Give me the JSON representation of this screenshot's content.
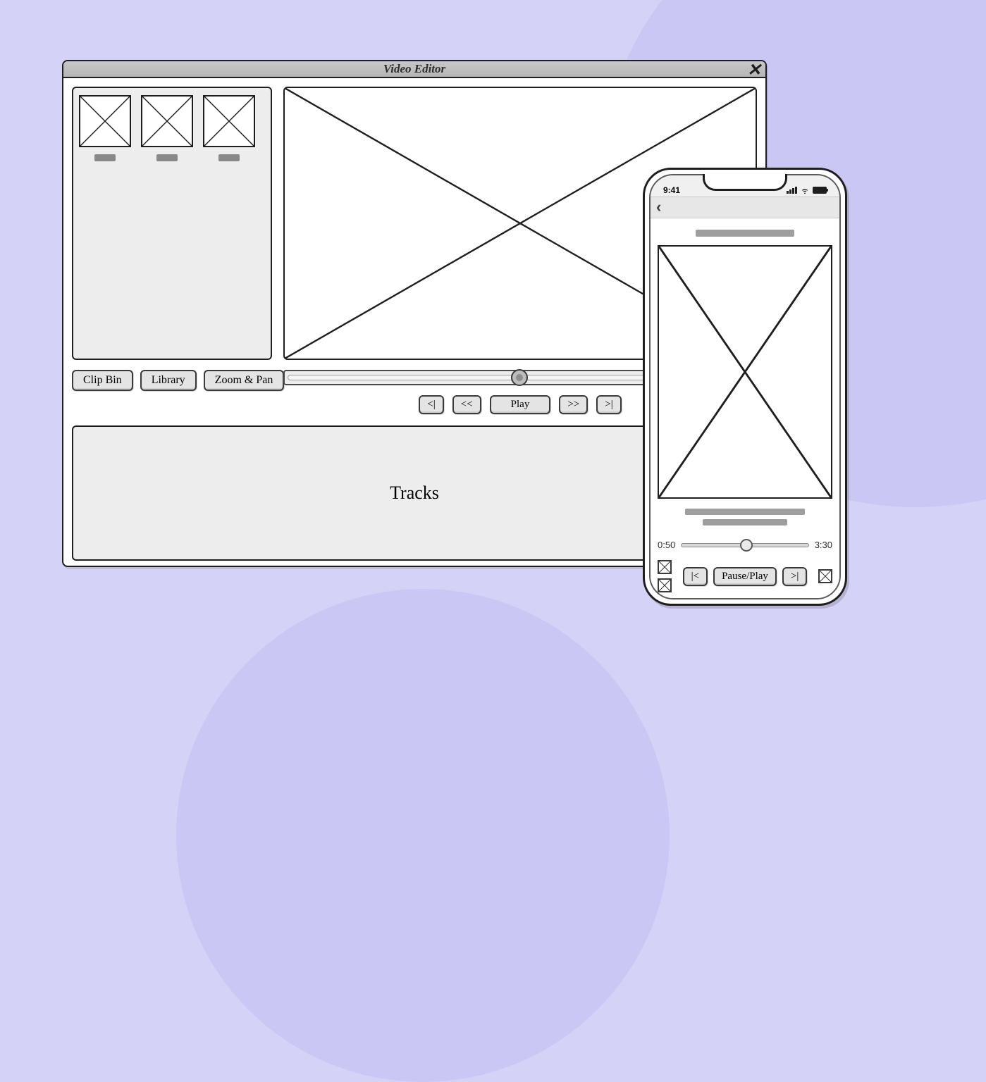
{
  "desktop": {
    "title": "Video Editor",
    "buttons": {
      "clip_bin": "Clip Bin",
      "library": "Library",
      "zoom_pan": "Zoom & Pan"
    },
    "transport": {
      "start": "<|",
      "rewind": "<<",
      "play": "Play",
      "forward": ">>",
      "end": ">|"
    },
    "tracks_label": "Tracks"
  },
  "phone": {
    "status_time": "9:41",
    "time_current": "0:50",
    "time_total": "3:30",
    "transport": {
      "prev": "|<",
      "pauseplay": "Pause/Play",
      "next": ">|"
    }
  }
}
